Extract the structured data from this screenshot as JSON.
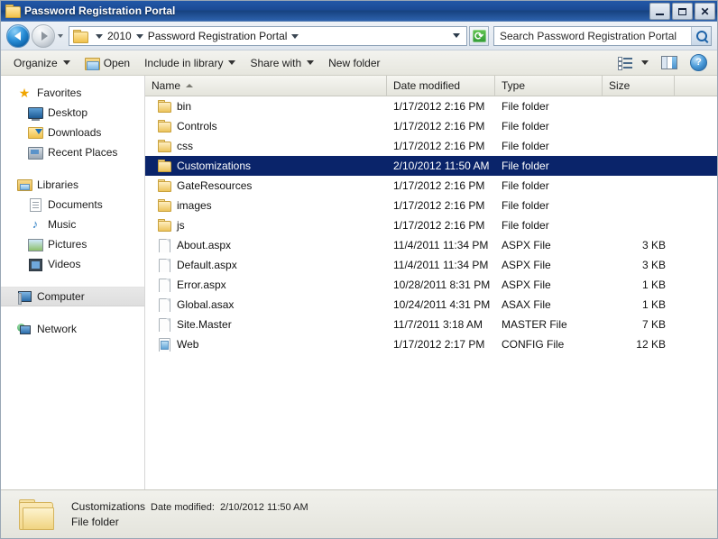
{
  "window": {
    "title": "Password Registration Portal",
    "controls": {
      "minimize": "–",
      "maximize": "□",
      "close": "✕"
    }
  },
  "addressbar": {
    "back_tooltip": "Back",
    "forward_tooltip": "Forward",
    "crumbs": [
      "2010",
      "Password Registration Portal"
    ],
    "refresh_label": "⟳",
    "search_value": "Search Password Registration Portal"
  },
  "toolbar": {
    "organize": "Organize",
    "open": "Open",
    "include_in_library": "Include in library",
    "share_with": "Share with",
    "new_folder": "New folder",
    "help": "?"
  },
  "sidebar": {
    "groups": [
      {
        "header": {
          "label": "Favorites",
          "icon": "star-icon"
        },
        "items": [
          {
            "label": "Desktop",
            "icon": "desktop-icon"
          },
          {
            "label": "Downloads",
            "icon": "downloads-icon"
          },
          {
            "label": "Recent Places",
            "icon": "recent-places-icon"
          }
        ]
      },
      {
        "header": {
          "label": "Libraries",
          "icon": "libraries-icon"
        },
        "items": [
          {
            "label": "Documents",
            "icon": "documents-icon"
          },
          {
            "label": "Music",
            "icon": "music-icon"
          },
          {
            "label": "Pictures",
            "icon": "pictures-icon"
          },
          {
            "label": "Videos",
            "icon": "videos-icon"
          }
        ]
      },
      {
        "header": {
          "label": "Computer",
          "icon": "computer-icon",
          "selected": true
        },
        "items": []
      },
      {
        "header": {
          "label": "Network",
          "icon": "network-icon"
        },
        "items": []
      }
    ]
  },
  "filelist": {
    "columns": {
      "name": "Name",
      "date_modified": "Date modified",
      "type": "Type",
      "size": "Size"
    },
    "sort": {
      "column": "Name",
      "direction": "asc"
    },
    "rows": [
      {
        "name": "bin",
        "date": "1/17/2012 2:16 PM",
        "type": "File folder",
        "size": "",
        "icon": "folder-icon",
        "selected": false
      },
      {
        "name": "Controls",
        "date": "1/17/2012 2:16 PM",
        "type": "File folder",
        "size": "",
        "icon": "folder-icon",
        "selected": false
      },
      {
        "name": "css",
        "date": "1/17/2012 2:16 PM",
        "type": "File folder",
        "size": "",
        "icon": "folder-icon",
        "selected": false
      },
      {
        "name": "Customizations",
        "date": "2/10/2012 11:50 AM",
        "type": "File folder",
        "size": "",
        "icon": "folder-icon",
        "selected": true
      },
      {
        "name": "GateResources",
        "date": "1/17/2012 2:16 PM",
        "type": "File folder",
        "size": "",
        "icon": "folder-icon",
        "selected": false
      },
      {
        "name": "images",
        "date": "1/17/2012 2:16 PM",
        "type": "File folder",
        "size": "",
        "icon": "folder-icon",
        "selected": false
      },
      {
        "name": "js",
        "date": "1/17/2012 2:16 PM",
        "type": "File folder",
        "size": "",
        "icon": "folder-icon",
        "selected": false
      },
      {
        "name": "About.aspx",
        "date": "11/4/2011 11:34 PM",
        "type": "ASPX File",
        "size": "3 KB",
        "icon": "file-icon",
        "selected": false
      },
      {
        "name": "Default.aspx",
        "date": "11/4/2011 11:34 PM",
        "type": "ASPX File",
        "size": "3 KB",
        "icon": "file-icon",
        "selected": false
      },
      {
        "name": "Error.aspx",
        "date": "10/28/2011 8:31 PM",
        "type": "ASPX File",
        "size": "1 KB",
        "icon": "file-icon",
        "selected": false
      },
      {
        "name": "Global.asax",
        "date": "10/24/2011 4:31 PM",
        "type": "ASAX File",
        "size": "1 KB",
        "icon": "file-icon",
        "selected": false
      },
      {
        "name": "Site.Master",
        "date": "11/7/2011 3:18 AM",
        "type": "MASTER File",
        "size": "7 KB",
        "icon": "file-icon",
        "selected": false
      },
      {
        "name": "Web",
        "date": "1/17/2012 2:17 PM",
        "type": "CONFIG File",
        "size": "12 KB",
        "icon": "config-icon",
        "selected": false
      }
    ]
  },
  "statusbar": {
    "item_name": "Customizations",
    "meta_label": "Date modified:",
    "meta_value": "2/10/2012 11:50 AM",
    "item_type": "File folder"
  },
  "colors": {
    "titlebar": "#1b4a94",
    "selection": "#0a246a",
    "toolbar": "#eeeee6",
    "folder_yellow": "#f0c14b"
  }
}
